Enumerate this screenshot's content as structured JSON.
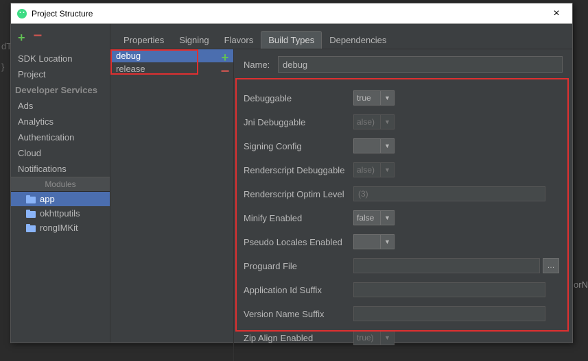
{
  "bg": {
    "code": "dT\n\n}",
    "right": "orN"
  },
  "window": {
    "title": "Project Structure",
    "close": "×"
  },
  "sidebar": {
    "items": [
      "SDK Location",
      "Project"
    ],
    "services_header": "Developer Services",
    "services": [
      "Ads",
      "Analytics",
      "Authentication",
      "Cloud",
      "Notifications"
    ],
    "modules_header": "Modules",
    "modules": [
      {
        "name": "app",
        "selected": true
      },
      {
        "name": "okhttputils",
        "selected": false
      },
      {
        "name": "rongIMKit",
        "selected": false
      }
    ]
  },
  "tabs": [
    "Properties",
    "Signing",
    "Flavors",
    "Build Types",
    "Dependencies"
  ],
  "active_tab": "Build Types",
  "build_types": [
    {
      "name": "debug",
      "selected": true
    },
    {
      "name": "release",
      "selected": false
    }
  ],
  "form": {
    "name": {
      "label": "Name:",
      "value": "debug"
    },
    "fields": [
      {
        "label": "Debuggable",
        "type": "select",
        "value": "true",
        "disabled": false
      },
      {
        "label": "Jni Debuggable",
        "type": "select",
        "value": "alse)",
        "disabled": true
      },
      {
        "label": "Signing Config",
        "type": "select",
        "value": "",
        "disabled": false
      },
      {
        "label": "Renderscript Debuggable",
        "type": "select",
        "value": "alse)",
        "disabled": true
      },
      {
        "label": "Renderscript Optim Level",
        "type": "text",
        "value": "(3)",
        "disabled": true
      },
      {
        "label": "Minify Enabled",
        "type": "select",
        "value": "false",
        "disabled": false
      },
      {
        "label": "Pseudo Locales Enabled",
        "type": "select",
        "value": "",
        "disabled": false
      },
      {
        "label": "Proguard File",
        "type": "file",
        "value": "",
        "disabled": false
      },
      {
        "label": "Application Id Suffix",
        "type": "text",
        "value": "",
        "disabled": false
      },
      {
        "label": "Version Name Suffix",
        "type": "text",
        "value": "",
        "disabled": false
      },
      {
        "label": "Zip Align Enabled",
        "type": "select",
        "value": "true)",
        "disabled": true
      }
    ]
  }
}
